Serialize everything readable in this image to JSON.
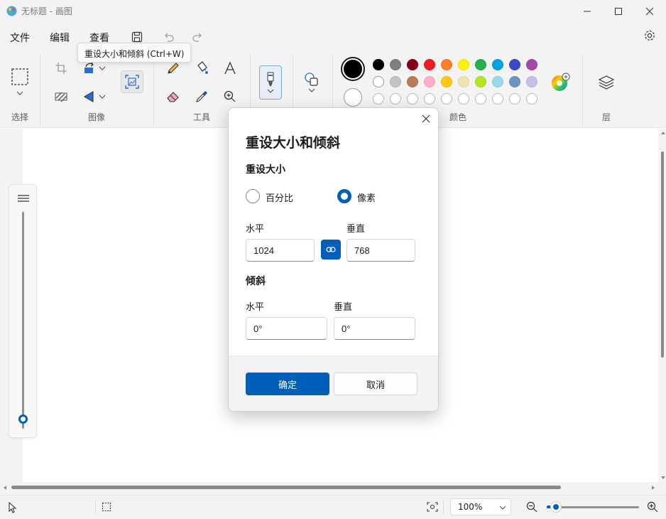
{
  "window": {
    "title": "无标题 - 画图"
  },
  "menu": {
    "file": "文件",
    "edit": "编辑",
    "view": "查看"
  },
  "ribbon": {
    "groups": {
      "selection": "选择",
      "image": "图像",
      "tools": "工具",
      "colors": "颜色",
      "layers": "层"
    },
    "tooltip": "重设大小和倾斜 (Ctrl+W)"
  },
  "palette": {
    "primary": "#000000",
    "secondary": "#ffffff",
    "row1": [
      "#000000",
      "#7f7f7f",
      "#880015",
      "#ed1c24",
      "#ff7f27",
      "#fff200",
      "#22b14c",
      "#00a2e8",
      "#3f48cc",
      "#a349a4"
    ],
    "row2": [
      "#ffffff",
      "#c3c3c3",
      "#b97a57",
      "#ffaec9",
      "#ffc90e",
      "#efe4b0",
      "#b5e61d",
      "#99d9ea",
      "#7092be",
      "#c8bfe7"
    ]
  },
  "dialog": {
    "title": "重设大小和倾斜",
    "resize_section": "重设大小",
    "percent_label": "百分比",
    "pixels_label": "像素",
    "selected_unit": "像素",
    "resize_horizontal_label": "水平",
    "resize_vertical_label": "垂直",
    "resize_horizontal_value": "1024",
    "resize_vertical_value": "768",
    "skew_section": "倾斜",
    "skew_horizontal_label": "水平",
    "skew_vertical_label": "垂直",
    "skew_horizontal_value": "0°",
    "skew_vertical_value": "0°",
    "ok": "确定",
    "cancel": "取消"
  },
  "status": {
    "zoom": "100%",
    "zoom_level": 0.1
  },
  "icons": [
    "paint-app-icon",
    "minimize-icon",
    "maximize-icon",
    "close-icon",
    "save-icon",
    "undo-icon",
    "redo-icon",
    "settings-icon",
    "select-icon",
    "crop-icon",
    "rotate-icon",
    "flip-icon",
    "image-resize-icon",
    "pencil-icon",
    "fill-icon",
    "text-icon",
    "eraser-icon",
    "color-picker-icon",
    "magnifier-icon",
    "brush-icon",
    "shapes-icon",
    "color-wheel-icon",
    "layers-icon",
    "link-icon",
    "pointer-icon",
    "selection-size-icon",
    "screenshot-icon",
    "zoom-out-icon",
    "zoom-in-icon"
  ]
}
